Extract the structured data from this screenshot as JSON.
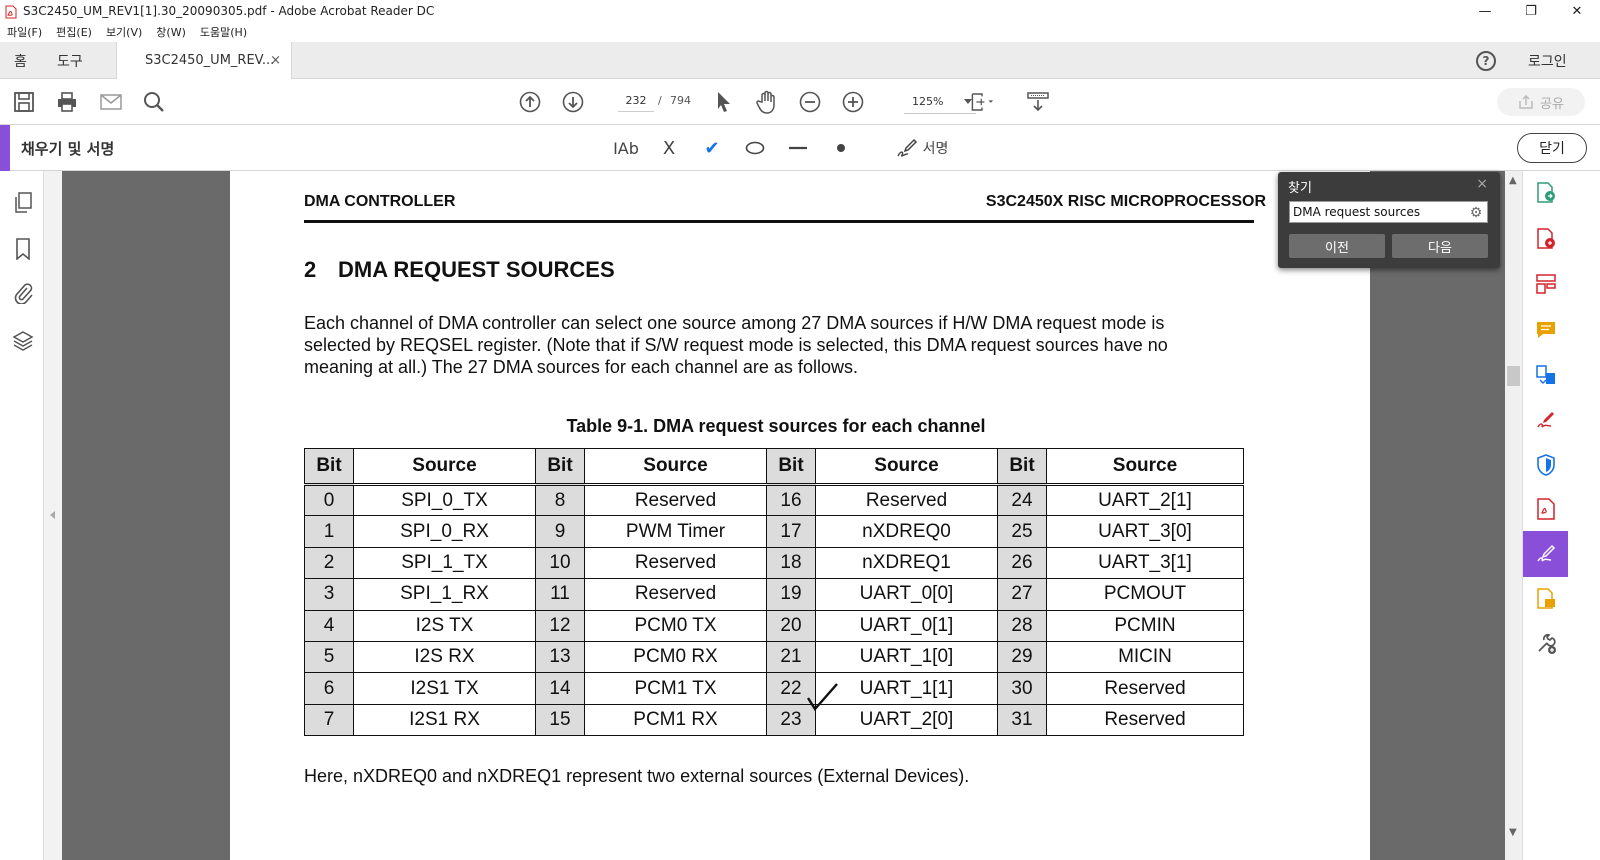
{
  "window": {
    "title": "S3C2450_UM_REV1[1].30_20090305.pdf - Adobe Acrobat Reader DC",
    "minimize": "—",
    "restore": "❐",
    "close": "✕"
  },
  "menu": [
    "파일(F)",
    "편집(E)",
    "보기(V)",
    "창(W)",
    "도움말(H)"
  ],
  "tabs": {
    "home": "홈",
    "tools": "도구",
    "document": "S3C2450_UM_REV...",
    "document_close": "×",
    "help": "?",
    "login": "로그인"
  },
  "toolbar": {
    "page_current": "232",
    "page_sep": "/",
    "page_total": "794",
    "zoom": "125%",
    "share": "공유"
  },
  "fill_sign": {
    "label": "채우기 및 서명",
    "text_tool": "IAb",
    "cross_tool": "X",
    "check_tool": "✔",
    "sign": "서명",
    "close": "닫기"
  },
  "find": {
    "title": "찾기",
    "close": "×",
    "query": "DMA request sources",
    "gear": "⚙",
    "prev": "이전",
    "next": "다음"
  },
  "document": {
    "running_left": "DMA CONTROLLER",
    "running_right": "S3C2450X RISC MICROPROCESSOR",
    "section_num": "2",
    "section_title": "DMA REQUEST SOURCES",
    "paragraph": "Each channel of DMA controller can select one source among 27 DMA sources if H/W DMA request mode is selected by REQSEL register. (Note that if S/W request mode is selected, this DMA request sources have no meaning at all.) The 27 DMA sources for each channel are as follows.",
    "table_caption": "Table 9-1. DMA request sources for each channel",
    "table_headers": [
      "Bit",
      "Source",
      "Bit",
      "Source",
      "Bit",
      "Source",
      "Bit",
      "Source"
    ],
    "table_rows": [
      [
        "0",
        "SPI_0_TX",
        "8",
        "Reserved",
        "16",
        "Reserved",
        "24",
        "UART_2[1]"
      ],
      [
        "1",
        "SPI_0_RX",
        "9",
        "PWM Timer",
        "17",
        "nXDREQ0",
        "25",
        "UART_3[0]"
      ],
      [
        "2",
        "SPI_1_TX",
        "10",
        "Reserved",
        "18",
        "nXDREQ1",
        "26",
        "UART_3[1]"
      ],
      [
        "3",
        "SPI_1_RX",
        "11",
        "Reserved",
        "19",
        "UART_0[0]",
        "27",
        "PCMOUT"
      ],
      [
        "4",
        "I2S TX",
        "12",
        "PCM0 TX",
        "20",
        "UART_0[1]",
        "28",
        "PCMIN"
      ],
      [
        "5",
        "I2S RX",
        "13",
        "PCM0 RX",
        "21",
        "UART_1[0]",
        "29",
        "MICIN"
      ],
      [
        "6",
        "I2S1 TX",
        "14",
        "PCM1 TX",
        "22",
        "UART_1[1]",
        "30",
        "Reserved"
      ],
      [
        "7",
        "I2S1 RX",
        "15",
        "PCM1 RX",
        "23",
        "UART_2[0]",
        "31",
        "Reserved"
      ]
    ],
    "footer": "Here, nXDREQ0 and nXDREQ1 represent two external sources (External Devices)."
  },
  "colors": {
    "accent": "#8a4fd8",
    "check_blue": "#1473e6",
    "viewport_bg": "#6a6a6a",
    "find_panel_bg": "#3c3c3c"
  }
}
